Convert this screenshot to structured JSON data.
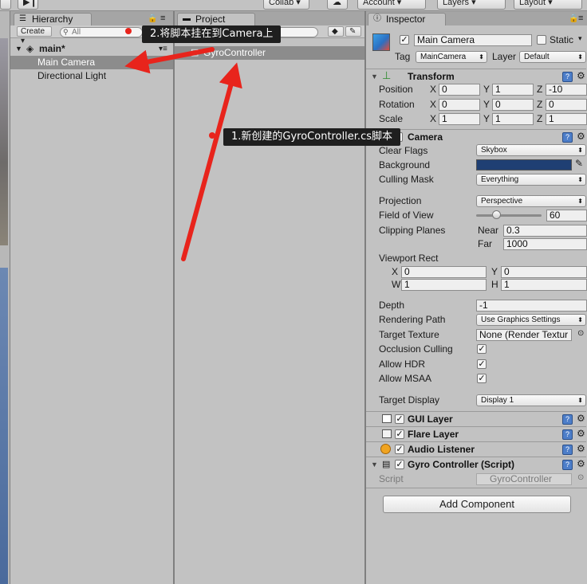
{
  "toolbar": {
    "collab": "Collab",
    "account": "Account",
    "layers": "Layers",
    "layout": "Layout"
  },
  "hierarchy": {
    "tab": "Hierarchy",
    "create": "Create",
    "search_placeholder": "All",
    "scene": "main*",
    "items": [
      "Main Camera",
      "Directional Light"
    ]
  },
  "project": {
    "tab": "Project",
    "asset": "GyroController"
  },
  "inspector": {
    "tab": "Inspector",
    "object_name": "Main Camera",
    "static_label": "Static",
    "tag_label": "Tag",
    "tag_value": "MainCamera",
    "layer_label": "Layer",
    "layer_value": "Default",
    "transform": {
      "title": "Transform",
      "position_label": "Position",
      "rotation_label": "Rotation",
      "scale_label": "Scale",
      "x": "X",
      "y": "Y",
      "z": "Z",
      "position": [
        "0",
        "1",
        "-10"
      ],
      "rotation": [
        "0",
        "0",
        "0"
      ],
      "scale": [
        "1",
        "1",
        "1"
      ]
    },
    "camera": {
      "title": "Camera",
      "clear_flags_label": "Clear Flags",
      "clear_flags": "Skybox",
      "background_label": "Background",
      "background_color": "#1f3f73",
      "culling_mask_label": "Culling Mask",
      "culling_mask": "Everything",
      "projection_label": "Projection",
      "projection": "Perspective",
      "fov_label": "Field of View",
      "fov": "60",
      "fov_fraction": 0.3,
      "clipping_label": "Clipping Planes",
      "near_label": "Near",
      "near": "0.3",
      "far_label": "Far",
      "far": "1000",
      "viewport_label": "Viewport Rect",
      "vx_label": "X",
      "vx": "0",
      "vy_label": "Y",
      "vy": "0",
      "vw_label": "W",
      "vw": "1",
      "vh_label": "H",
      "vh": "1",
      "depth_label": "Depth",
      "depth": "-1",
      "rendering_path_label": "Rendering Path",
      "rendering_path": "Use Graphics Settings",
      "target_texture_label": "Target Texture",
      "target_texture": "None (Render Textur",
      "occlusion_label": "Occlusion Culling",
      "hdr_label": "Allow HDR",
      "msaa_label": "Allow MSAA",
      "target_display_label": "Target Display",
      "target_display": "Display 1"
    },
    "gui_layer": "GUI Layer",
    "flare_layer": "Flare Layer",
    "audio_listener": "Audio Listener",
    "gyro": {
      "title": "Gyro Controller (Script)",
      "script_label": "Script",
      "script_value": "GyroController"
    },
    "add_component": "Add Component"
  },
  "annotations": {
    "step1": "1.新创建的GyroController.cs脚本",
    "step2": "2.将脚本挂在到Camera上",
    "arrow_color": "#e8241c"
  }
}
